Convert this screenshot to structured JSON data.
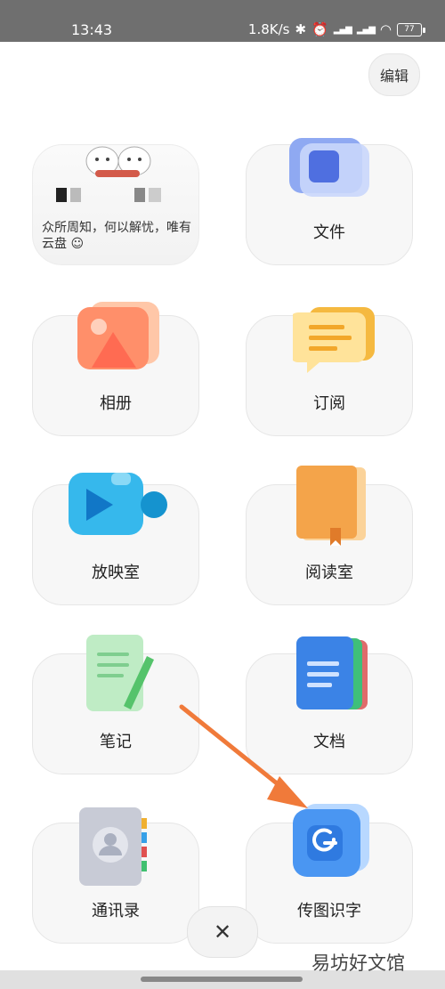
{
  "status_bar": {
    "time": "13:43",
    "speed": "1.8K/s",
    "battery": "77"
  },
  "header": {
    "edit_label": "编辑"
  },
  "preview_card": {
    "text": "众所周知，何以解忧，唯有云盘 ☺"
  },
  "grid": {
    "files": "文件",
    "album": "相册",
    "subscribe": "订阅",
    "theater": "放映室",
    "reading_room": "阅读室",
    "notes": "笔记",
    "docs": "文档",
    "contacts": "通讯录",
    "ocr": "传图识字"
  },
  "watermark": "易坊好文馆",
  "colors": {
    "arrow": "#f07a3a"
  }
}
